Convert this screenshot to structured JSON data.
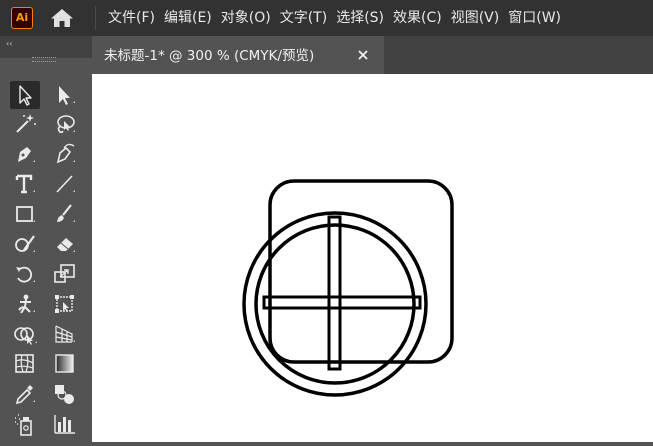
{
  "app": {
    "logo_text": "Ai",
    "accent_color": "#ff9a00"
  },
  "menu": {
    "items": [
      "文件(F)",
      "编辑(E)",
      "对象(O)",
      "文字(T)",
      "选择(S)",
      "效果(C)",
      "视图(V)",
      "窗口(W)"
    ]
  },
  "document_tab": {
    "title": "未标题-1* @ 300 % (CMYK/预览)"
  },
  "toolbar": {
    "collapse_glyph": "‹‹",
    "tools": [
      {
        "name": "selection-tool-icon",
        "selected": true
      },
      {
        "name": "direct-selection-tool-icon",
        "selected": false
      },
      {
        "name": "magic-wand-tool-icon",
        "selected": false
      },
      {
        "name": "lasso-tool-icon",
        "selected": false
      },
      {
        "name": "pen-tool-icon",
        "selected": false
      },
      {
        "name": "curvature-tool-icon",
        "selected": false
      },
      {
        "name": "type-tool-icon",
        "selected": false
      },
      {
        "name": "line-segment-tool-icon",
        "selected": false
      },
      {
        "name": "rectangle-tool-icon",
        "selected": false
      },
      {
        "name": "paintbrush-tool-icon",
        "selected": false
      },
      {
        "name": "shaper-tool-icon",
        "selected": false
      },
      {
        "name": "eraser-tool-icon",
        "selected": false
      },
      {
        "name": "rotate-tool-icon",
        "selected": false
      },
      {
        "name": "scale-tool-icon",
        "selected": false
      },
      {
        "name": "puppet-warp-tool-icon",
        "selected": false
      },
      {
        "name": "free-transform-tool-icon",
        "selected": false
      },
      {
        "name": "shape-builder-tool-icon",
        "selected": false
      },
      {
        "name": "perspective-grid-tool-icon",
        "selected": false
      },
      {
        "name": "mesh-tool-icon",
        "selected": false
      },
      {
        "name": "gradient-tool-icon",
        "selected": false
      },
      {
        "name": "eyedropper-tool-icon",
        "selected": false
      },
      {
        "name": "blend-tool-icon",
        "selected": false
      },
      {
        "name": "symbol-sprayer-tool-icon",
        "selected": false
      },
      {
        "name": "column-graph-tool-icon",
        "selected": false
      }
    ]
  },
  "artwork": {
    "shapes": [
      "rounded-square",
      "outer-circle",
      "inner-circle",
      "vertical-bar",
      "horizontal-bar"
    ],
    "stroke_color": "#000000"
  }
}
